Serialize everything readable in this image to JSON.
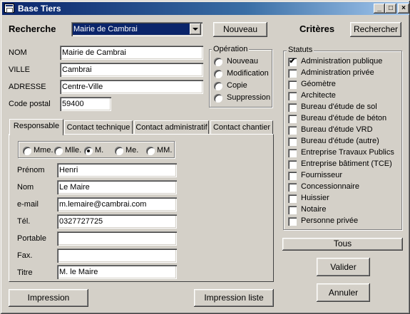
{
  "window": {
    "title": "Base Tiers",
    "minimize": "_",
    "maximize": "□",
    "close": "×"
  },
  "header": {
    "recherche_label": "Recherche",
    "recherche_value": "Mairie de Cambrai",
    "nouveau_button": "Nouveau",
    "criteres_label": "Critères",
    "rechercher_button": "Rechercher"
  },
  "fields": {
    "nom": {
      "label": "NOM",
      "value": "Mairie de Cambrai"
    },
    "ville": {
      "label": "VILLE",
      "value": "Cambrai"
    },
    "adresse": {
      "label": "ADRESSE",
      "value": "Centre-Ville"
    },
    "code_postal": {
      "label": "Code postal",
      "value": "59400"
    }
  },
  "operation": {
    "title": "Opération",
    "options": [
      "Nouveau",
      "Modification",
      "Copie",
      "Suppression"
    ],
    "selected": -1
  },
  "tabs": [
    "Responsable",
    "Contact technique",
    "Contact administratif",
    "Contact chantier"
  ],
  "active_tab": 0,
  "civilite": {
    "options": [
      "Mme.",
      "Mlle.",
      "M.",
      "Me.",
      "MM."
    ],
    "selected": 2
  },
  "contact": {
    "prenom": {
      "label": "Prénom",
      "value": "Henri"
    },
    "nom": {
      "label": "Nom",
      "value": "Le Maire"
    },
    "email": {
      "label": "e-mail",
      "value": "m.lemaire@cambrai.com"
    },
    "tel": {
      "label": "Tél.",
      "value": "0327727725"
    },
    "portable": {
      "label": "Portable",
      "value": ""
    },
    "fax": {
      "label": "Fax.",
      "value": ""
    },
    "titre": {
      "label": "Titre",
      "value": "M. le Maire"
    }
  },
  "statuts": {
    "title": "Statuts",
    "items": [
      {
        "label": "Administration publique",
        "checked": true
      },
      {
        "label": "Administration privée",
        "checked": false
      },
      {
        "label": "Géomètre",
        "checked": false
      },
      {
        "label": "Architecte",
        "checked": false
      },
      {
        "label": "Bureau d'étude de sol",
        "checked": false
      },
      {
        "label": "Bureau d'étude de béton",
        "checked": false
      },
      {
        "label": "Bureau d'étude VRD",
        "checked": false
      },
      {
        "label": "Bureau d'étude (autre)",
        "checked": false
      },
      {
        "label": "Entreprise Travaux Publics",
        "checked": false
      },
      {
        "label": "Entreprise bâtiment (TCE)",
        "checked": false
      },
      {
        "label": "Fournisseur",
        "checked": false
      },
      {
        "label": "Concessionnaire",
        "checked": false
      },
      {
        "label": "Huissier",
        "checked": false
      },
      {
        "label": "Notaire",
        "checked": false
      },
      {
        "label": "Personne privée",
        "checked": false
      }
    ],
    "check_mark": "✔"
  },
  "buttons": {
    "tous": "Tous",
    "valider": "Valider",
    "annuler": "Annuler",
    "impression": "Impression",
    "impression_liste": "Impression liste"
  }
}
